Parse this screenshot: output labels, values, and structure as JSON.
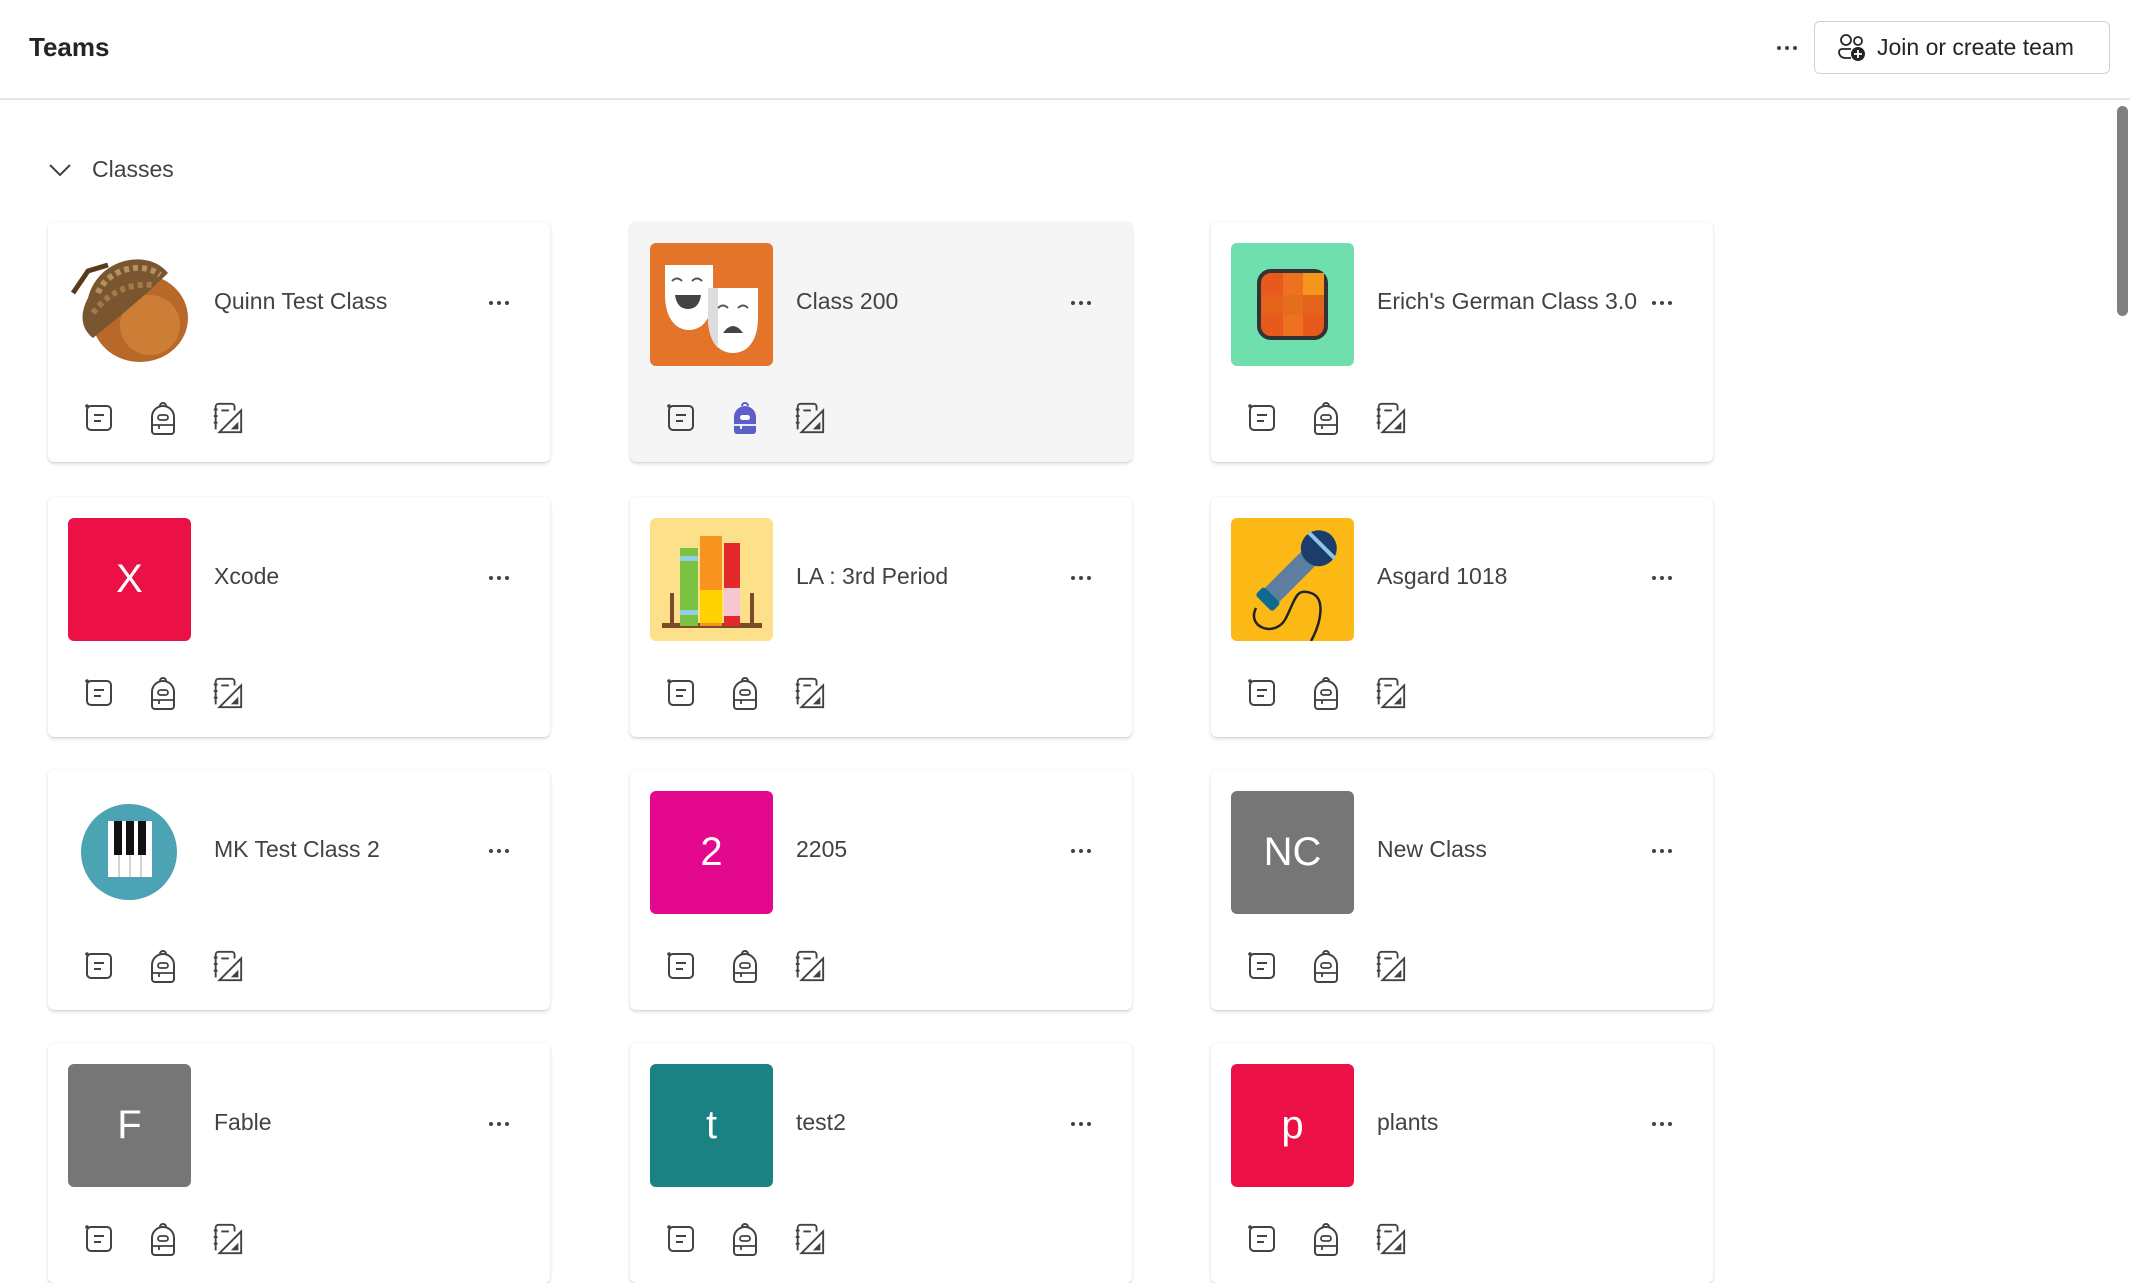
{
  "header": {
    "title": "Teams",
    "more_icon": "more-horizontal-icon",
    "join_button": {
      "label": "Join or create team",
      "icon": "people-add-icon"
    }
  },
  "section": {
    "label": "Classes",
    "expanded": true,
    "icon": "chevron-down-icon"
  },
  "colors": {
    "active_icon": "#5b5fc7",
    "hover_card_bg": "#f5f5f5"
  },
  "cards": [
    {
      "name": "Quinn Test Class",
      "avatar_type": "image",
      "avatar_image": "acorn",
      "avatar_bg": "#ffffff",
      "hovered": false
    },
    {
      "name": "Class 200",
      "avatar_type": "image",
      "avatar_image": "theater-masks",
      "avatar_bg": "#e3742a",
      "hovered": true,
      "active_icon": "backpack"
    },
    {
      "name": "Erich's German Class 3.0",
      "avatar_type": "image",
      "avatar_image": "orange-tile",
      "avatar_bg": "#6fdfad",
      "hovered": false
    },
    {
      "name": "Xcode",
      "avatar_type": "initials",
      "initials": "X",
      "avatar_bg": "#eb1045",
      "hovered": false
    },
    {
      "name": "LA : 3rd Period",
      "avatar_type": "image",
      "avatar_image": "books",
      "avatar_bg": "#fde08a",
      "hovered": false
    },
    {
      "name": "Asgard 1018",
      "avatar_type": "image",
      "avatar_image": "microphone",
      "avatar_bg": "#fcb916",
      "hovered": false
    },
    {
      "name": "MK Test Class 2",
      "avatar_type": "image",
      "avatar_image": "piano-keys",
      "avatar_bg": "#ffffff",
      "hovered": false
    },
    {
      "name": "2205",
      "avatar_type": "initials",
      "initials": "2",
      "avatar_bg": "#e3088d",
      "hovered": false
    },
    {
      "name": "New Class",
      "avatar_type": "initials",
      "initials": "NC",
      "avatar_bg": "#767676",
      "hovered": false
    },
    {
      "name": "Fable",
      "avatar_type": "initials",
      "initials": "F",
      "avatar_bg": "#767676",
      "hovered": false
    },
    {
      "name": "test2",
      "avatar_type": "initials",
      "initials": "t",
      "avatar_bg": "#1a8282",
      "hovered": false
    },
    {
      "name": "plants",
      "avatar_type": "initials",
      "initials": "p",
      "avatar_bg": "#eb1045",
      "hovered": false
    }
  ],
  "card_icons": [
    "posts-icon",
    "assignments-backpack-icon",
    "class-notebook-icon"
  ]
}
